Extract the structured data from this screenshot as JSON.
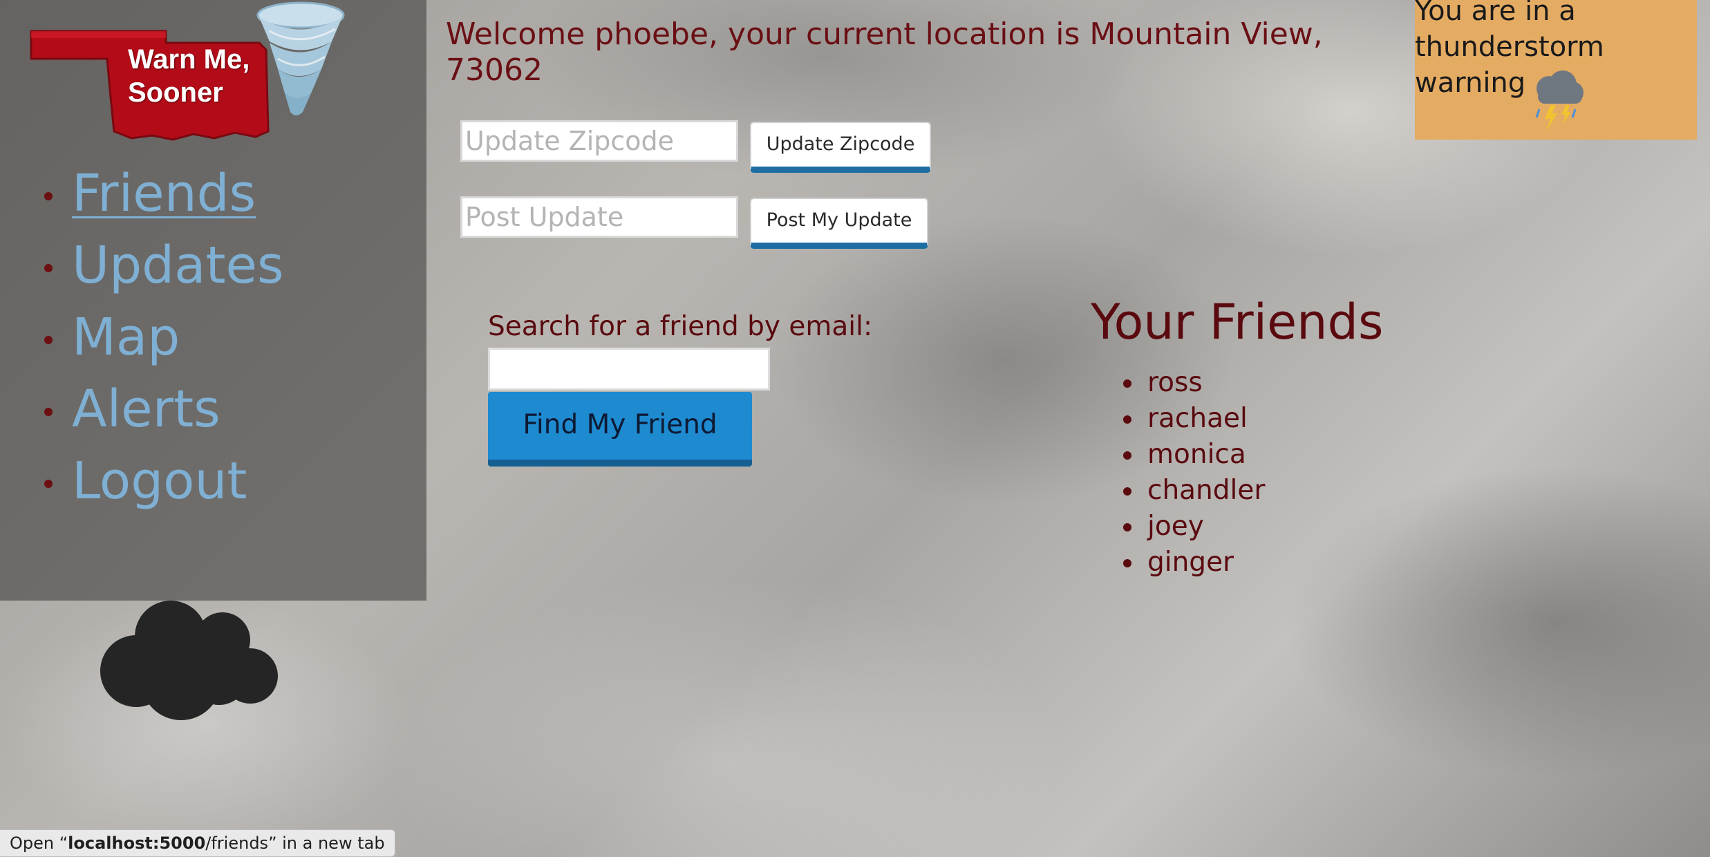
{
  "logo": {
    "text": "Warn Me,\nSooner"
  },
  "nav": {
    "items": [
      {
        "label": "Friends",
        "active": true
      },
      {
        "label": "Updates"
      },
      {
        "label": "Map"
      },
      {
        "label": "Alerts"
      },
      {
        "label": "Logout"
      }
    ]
  },
  "welcome": {
    "text": "Welcome phoebe, your current location is Mountain View, 73062"
  },
  "zipcode": {
    "placeholder": "Update Zipcode",
    "button_label": "Update Zipcode"
  },
  "post": {
    "placeholder": "Post Update",
    "button_label": "Post My Update"
  },
  "search": {
    "label": "Search for a friend by email:",
    "value": "",
    "button_label": "Find My Friend"
  },
  "friends": {
    "title": "Your Friends",
    "list": [
      "ross",
      "rachael",
      "monica",
      "chandler",
      "joey",
      "ginger"
    ]
  },
  "alert": {
    "text": "You are in a thunderstorm warning",
    "icon": "thunderstorm-icon",
    "color": "#e4ab63"
  },
  "statusbar": {
    "prefix": "Open “",
    "host": "localhost:5000",
    "path": "/friends",
    "suffix": "” in a new tab"
  },
  "colors": {
    "heading": "#6a0f14",
    "link": "#7fb0d4",
    "primary_button": "#1e8ad0"
  }
}
